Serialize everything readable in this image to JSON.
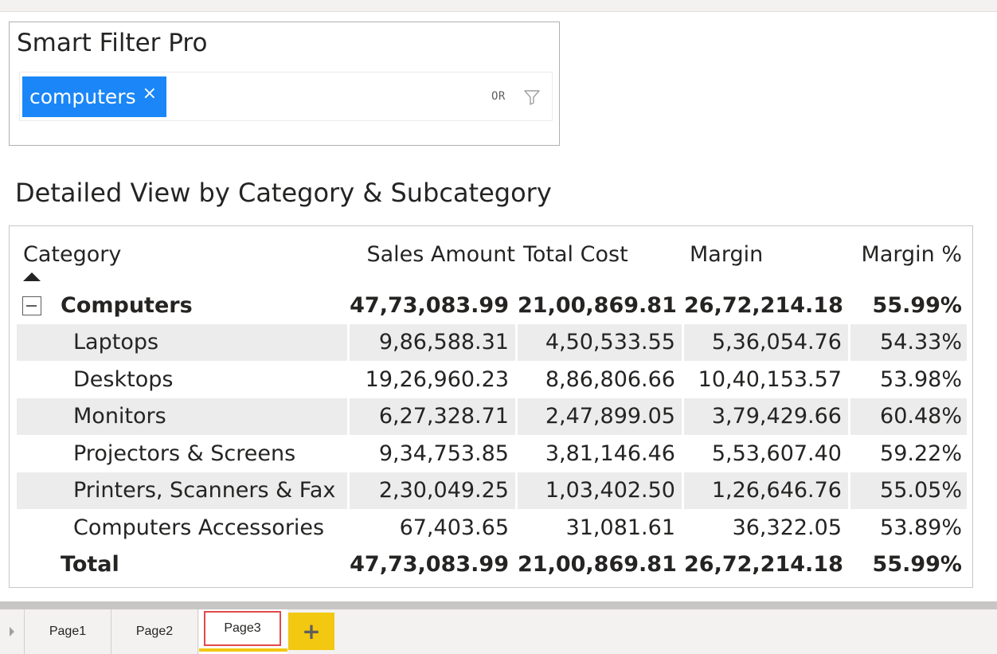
{
  "smart_filter": {
    "title": "Smart Filter Pro",
    "chip_label": "computers",
    "chip_close": "×",
    "logic_label": "OR",
    "icons": {
      "funnel": "funnel-icon",
      "close": "close-icon"
    },
    "chip_color": "#1a86f7"
  },
  "matrix": {
    "title": "Detailed View by Category & Subcategory",
    "headers": [
      "Category",
      "Sales Amount",
      "Total Cost",
      "Margin",
      "Margin %"
    ],
    "sort_indicator": "ascending",
    "category": {
      "name": "Computers",
      "sales": "47,73,083.99",
      "cost": "21,00,869.81",
      "margin": "26,72,214.18",
      "margin_pct": "55.99%"
    },
    "rows": [
      {
        "name": "Laptops",
        "sales": "9,86,588.31",
        "cost": "4,50,533.55",
        "margin": "5,36,054.76",
        "margin_pct": "54.33%"
      },
      {
        "name": "Desktops",
        "sales": "19,26,960.23",
        "cost": "8,86,806.66",
        "margin": "10,40,153.57",
        "margin_pct": "53.98%"
      },
      {
        "name": "Monitors",
        "sales": "6,27,328.71",
        "cost": "2,47,899.05",
        "margin": "3,79,429.66",
        "margin_pct": "60.48%"
      },
      {
        "name": "Projectors & Screens",
        "sales": "9,34,753.85",
        "cost": "3,81,146.46",
        "margin": "5,53,607.40",
        "margin_pct": "59.22%"
      },
      {
        "name": "Printers, Scanners & Fax",
        "sales": "2,30,049.25",
        "cost": "1,03,402.50",
        "margin": "1,26,646.76",
        "margin_pct": "55.05%"
      },
      {
        "name": "Computers Accessories",
        "sales": "67,403.65",
        "cost": "31,081.61",
        "margin": "36,322.05",
        "margin_pct": "53.89%"
      }
    ],
    "total": {
      "name": "Total",
      "sales": "47,73,083.99",
      "cost": "21,00,869.81",
      "margin": "26,72,214.18",
      "margin_pct": "55.99%"
    },
    "row_shade_color": "#ececec"
  },
  "tabs": {
    "items": [
      "Page1",
      "Page2",
      "Page3"
    ],
    "active": "Page3",
    "add_label": "+",
    "accent_color": "#f2c811",
    "active_outline_color": "#e04a4a"
  }
}
